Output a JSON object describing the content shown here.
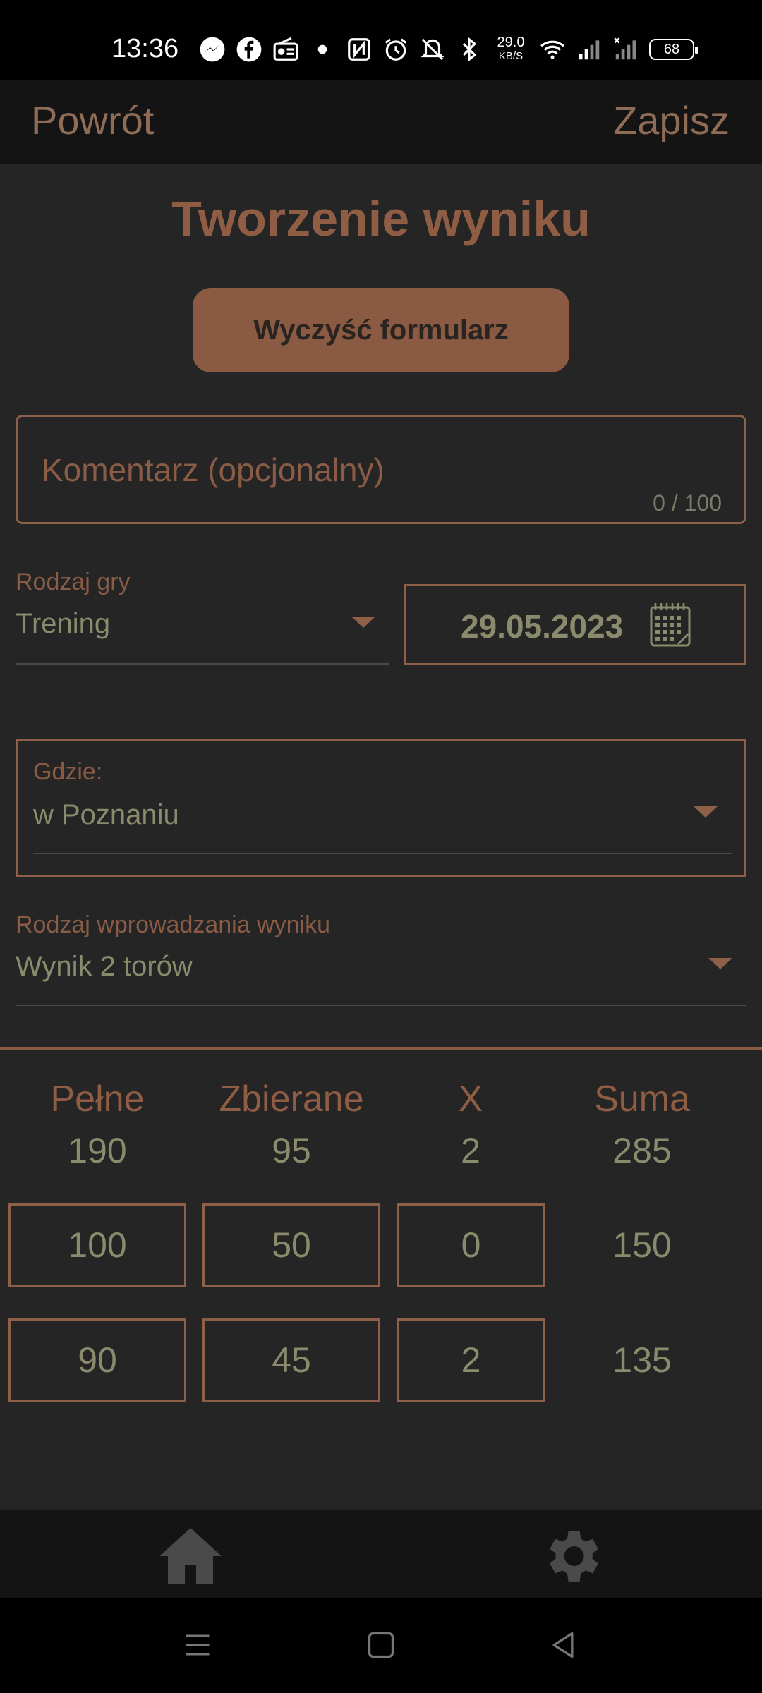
{
  "status_bar": {
    "time": "13:36",
    "net_speed_value": "29.0",
    "net_speed_unit": "KB/S",
    "battery": "68",
    "icons": [
      "messenger-icon",
      "facebook-icon",
      "radio-icon",
      "dot-icon",
      "nfc-icon",
      "alarm-icon",
      "mute-icon",
      "bluetooth-icon",
      "wifi-icon",
      "signal-icon",
      "signal-empty-icon"
    ]
  },
  "top_bar": {
    "back_label": "Powrót",
    "save_label": "Zapisz"
  },
  "page": {
    "title": "Tworzenie wyniku",
    "clear_button": "Wyczyść formularz"
  },
  "comment": {
    "placeholder": "Komentarz (opcjonalny)",
    "counter": "0 / 100"
  },
  "game_type": {
    "label": "Rodzaj gry",
    "value": "Trening"
  },
  "date": {
    "value": "29.05.2023",
    "icon": "calendar-icon"
  },
  "where": {
    "label": "Gdzie:",
    "value": "w Poznaniu"
  },
  "entry_type": {
    "label": "Rodzaj wprowadzania wyniku",
    "value": "Wynik 2 torów"
  },
  "score_table": {
    "headers": [
      "Pełne",
      "Zbierane",
      "X",
      "Suma"
    ],
    "totals": [
      "190",
      "95",
      "2",
      "285"
    ],
    "rows": [
      {
        "full": "100",
        "collected": "50",
        "x": "0",
        "sum": "150"
      },
      {
        "full": "90",
        "collected": "45",
        "x": "2",
        "sum": "135"
      }
    ]
  },
  "bottom_nav": {
    "home_icon": "home-icon",
    "settings_icon": "gear-icon"
  },
  "system_nav": {
    "menu_icon": "menu-icon",
    "home_icon": "square-icon",
    "back_icon": "back-triangle-icon"
  },
  "colors": {
    "accent": "#8f6049",
    "background": "#252525",
    "text": "#8a8a6c",
    "button": "#8a5a42"
  }
}
